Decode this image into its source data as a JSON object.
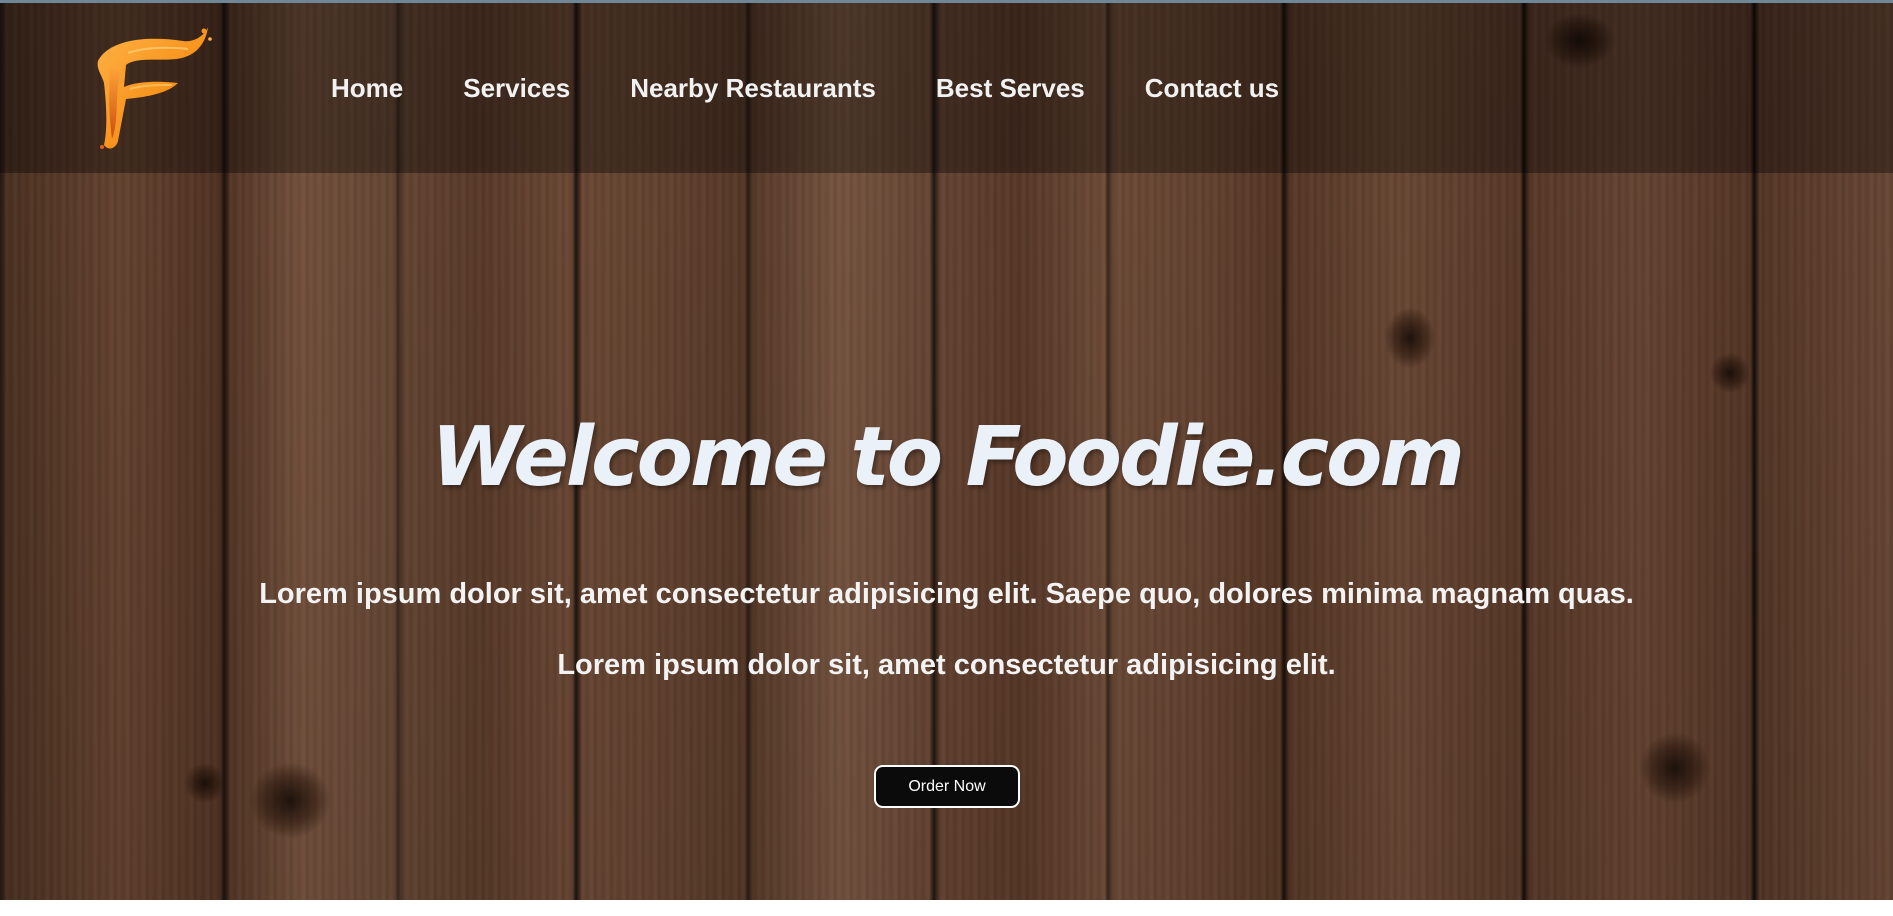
{
  "brand": {
    "logo_icon": "orange-swirl-f-logo",
    "logo_colors": [
      "#f7941d",
      "#e85d14",
      "#ffb347"
    ]
  },
  "nav": {
    "items": [
      {
        "label": "Home"
      },
      {
        "label": "Services"
      },
      {
        "label": "Nearby Restaurants"
      },
      {
        "label": "Best Serves"
      },
      {
        "label": "Contact us"
      }
    ]
  },
  "hero": {
    "background": "dark-wood-planks",
    "headline": "Welcome to Foodie.com",
    "tagline_1": "Lorem ipsum dolor sit, amet consectetur adipisicing elit. Saepe quo, dolores minima magnam quas.",
    "tagline_2": "Lorem ipsum dolor sit, amet consectetur adipisicing elit.",
    "cta_label": "Order Now"
  },
  "colors": {
    "headline": "#eaf1f8",
    "text": "#f3f3f3",
    "button_bg": "#0b0b0b",
    "button_border": "#ffffff"
  }
}
